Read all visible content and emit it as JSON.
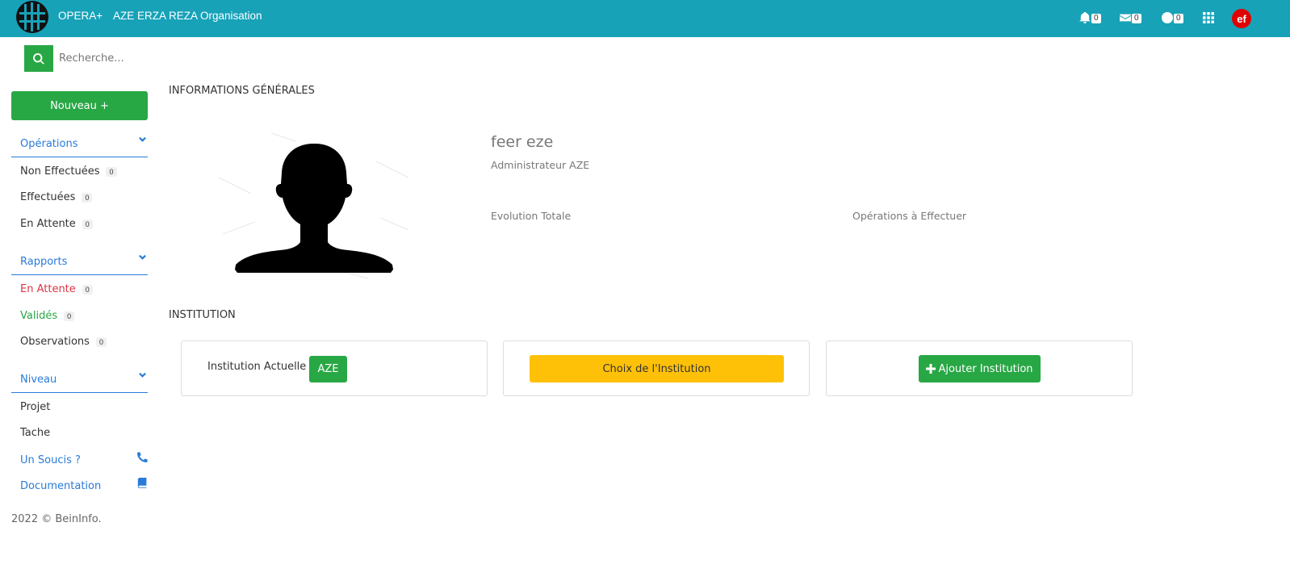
{
  "header": {
    "app_name": "OPERA+",
    "org_name": "AZE ERZA REZA Organisation",
    "notifications_count": "0",
    "messages_count": "0",
    "history_count": "0",
    "user_initials": "ef",
    "brand_color": "#17a2b8",
    "avatar_color": "#e00000"
  },
  "sidebar": {
    "search_placeholder": "Recherche...",
    "new_button": "Nouveau +",
    "operations": {
      "title": "Opérations",
      "items": [
        {
          "label": "Non Effectuées",
          "count": "0"
        },
        {
          "label": "Effectuées",
          "count": "0"
        },
        {
          "label": "En Attente",
          "count": "0"
        }
      ]
    },
    "rapports": {
      "title": "Rapports",
      "items": [
        {
          "label": "En Attente",
          "count": "0"
        },
        {
          "label": "Validés",
          "count": "0"
        },
        {
          "label": "Observations",
          "count": "0"
        }
      ]
    },
    "niveau": {
      "title": "Niveau",
      "items": [
        {
          "label": "Projet"
        },
        {
          "label": "Tache"
        }
      ]
    },
    "support": {
      "label": "Un Soucis ?",
      "icon": "phone-icon"
    },
    "docs": {
      "label": "Documentation",
      "icon": "book-icon"
    },
    "footer": "2022 © BeinInfo."
  },
  "main": {
    "general_info_title": "INFORMATIONS GÉNÉRALES",
    "profile": {
      "name": "feer eze",
      "role": "Administrateur AZE"
    },
    "stats": {
      "evolution_label": "Evolution Totale",
      "operations_label": "Opérations à Effectuer"
    },
    "institution": {
      "title": "INSTITUTION",
      "current_label": "Institution Actuelle :",
      "current_value": "AZE",
      "choose_button": "Choix de l'Institution",
      "add_button": "Ajouter Institution"
    }
  },
  "colors": {
    "green": "#28a745",
    "yellow": "#ffc107",
    "link_blue": "#2a7bd8",
    "danger_red": "#dc3545"
  }
}
